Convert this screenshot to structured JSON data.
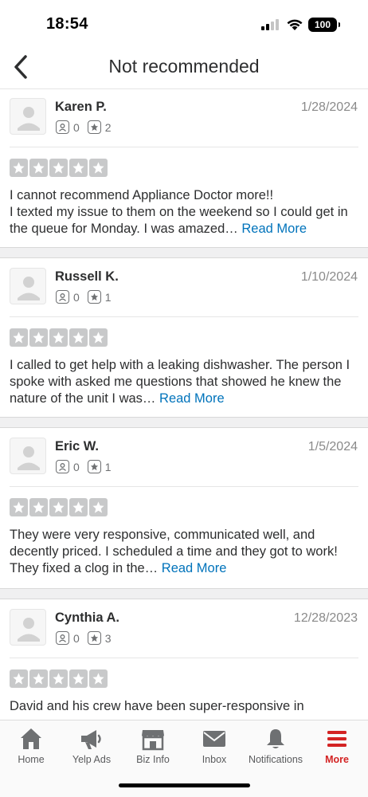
{
  "status": {
    "time": "18:54",
    "battery": "100"
  },
  "nav": {
    "title": "Not recommended"
  },
  "reviews": [
    {
      "name": "Karen P.",
      "date": "1/28/2024",
      "friends": "0",
      "reviews": "2",
      "rating": 5,
      "text": "I cannot recommend Appliance Doctor more!!\nI texted my issue to them on the weekend so I could get in the queue for Monday. I was amazed…",
      "read_more": "Read More"
    },
    {
      "name": "Russell K.",
      "date": "1/10/2024",
      "friends": "0",
      "reviews": "1",
      "rating": 5,
      "text": "I called to get help with a leaking dishwasher.  The person I spoke with asked me questions that showed he knew the nature of the unit I was…",
      "read_more": "Read More"
    },
    {
      "name": "Eric W.",
      "date": "1/5/2024",
      "friends": "0",
      "reviews": "1",
      "rating": 5,
      "text": "They were very responsive, communicated well, and decently priced.  I scheduled a time and they got to work!  They fixed a clog in the…",
      "read_more": "Read More"
    },
    {
      "name": "Cynthia A.",
      "date": "12/28/2023",
      "friends": "0",
      "reviews": "3",
      "rating": 5,
      "text": "David and his crew have been super-responsive in",
      "read_more": ""
    }
  ],
  "tabs": [
    {
      "label": "Home",
      "icon": "home-icon"
    },
    {
      "label": "Yelp Ads",
      "icon": "megaphone-icon"
    },
    {
      "label": "Biz Info",
      "icon": "storefront-icon"
    },
    {
      "label": "Inbox",
      "icon": "envelope-icon"
    },
    {
      "label": "Notifications",
      "icon": "bell-icon"
    },
    {
      "label": "More",
      "icon": "menu-icon",
      "active": true
    }
  ],
  "colors": {
    "accent": "#d32323",
    "link": "#0073bb",
    "star_empty": "#c8c9ca"
  }
}
